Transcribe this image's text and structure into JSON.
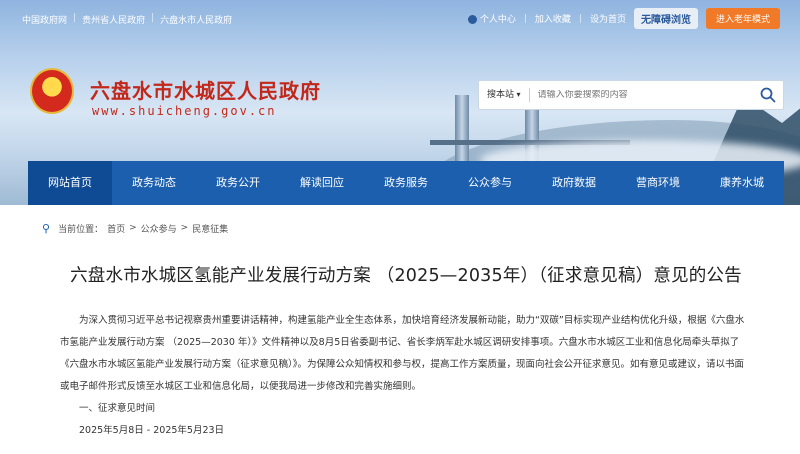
{
  "topbar": {
    "links": [
      "中国政府网",
      "贵州省人民政府",
      "六盘水市人民政府"
    ],
    "user_center": "个人中心",
    "favorite": "加入收藏",
    "set_home": "设为首页",
    "accessibility": "无障碍浏览",
    "elder_mode": "进入老年模式"
  },
  "site": {
    "title": "六盘水市水城区人民政府",
    "url": "www.shuicheng.gov.cn"
  },
  "search": {
    "scope": "搜本站",
    "placeholder": "请输入你要搜索的内容"
  },
  "nav": [
    "网站首页",
    "政务动态",
    "政务公开",
    "解读回应",
    "政务服务",
    "公众参与",
    "政府数据",
    "营商环境",
    "康养水城"
  ],
  "breadcrumb": {
    "prefix": "当前位置：",
    "items": [
      "首页",
      "公众参与",
      "民意征集"
    ],
    "sep": ">"
  },
  "article": {
    "title": "六盘水市水城区氢能产业发展行动方案 （2025—2035年）（征求意见稿）意见的公告",
    "paragraph": "为深入贯彻习近平总书记视察贵州重要讲话精神，构建氢能产业全生态体系，加快培育经济发展新动能，助力“双碳”目标实现产业结构优化升级，根据《六盘水市氢能产业发展行动方案 （2025—2030 年）》文件精神以及8月5日省委副书记、省长李炳军赴水城区调研安排事项。六盘水市水城区工业和信息化局牵头草拟了《六盘水市水城区氢能产业发展行动方案（征求意见稿）》。为保障公众知情权和参与权，提高工作方案质量，现面向社会公开征求意见。如有意见或建议，请以书面或电子邮件形式反馈至水城区工业和信息化局，以便我局进一步修改和完善实施细则。",
    "section1": "一、征求意见时间",
    "dates": "2025年5月8日 - 2025年5月23日"
  },
  "colors": {
    "brand_red": "#c3271a",
    "nav_blue": "#1b5fae",
    "elder_orange": "#f07a28"
  }
}
